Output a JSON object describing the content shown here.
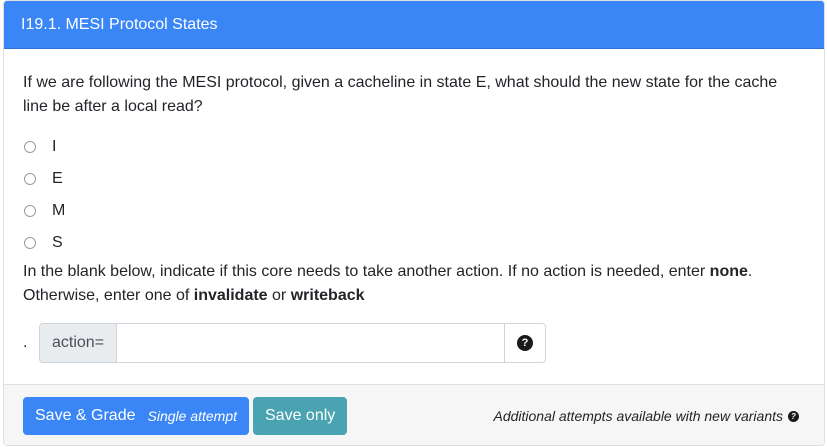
{
  "header": {
    "title": "I19.1. MESI Protocol States"
  },
  "question": {
    "text": "If we are following the MESI protocol, given a cacheline in state E, what should the new state for the cache line be after a local read?"
  },
  "options": [
    {
      "label": "I"
    },
    {
      "label": "E"
    },
    {
      "label": "M"
    },
    {
      "label": "S"
    }
  ],
  "instruction": {
    "part1": "In the blank below, indicate if this core needs to take another action. If no action is needed, enter ",
    "none": "none",
    "part2": ". Otherwise, enter one of ",
    "invalidate": "invalidate",
    "or": " or ",
    "writeback": "writeback"
  },
  "action": {
    "prefix": ".",
    "label": "action=",
    "value": "",
    "help_icon": "question-circle-icon"
  },
  "footer": {
    "save_grade_label": "Save & Grade",
    "save_grade_sub": "Single attempt",
    "save_only_label": "Save only",
    "note": "Additional attempts available with new variants",
    "note_icon": "question-circle-icon"
  },
  "colors": {
    "header_bg": "#3a86f7",
    "primary": "#3a86f7",
    "info": "#4aa3b0"
  }
}
